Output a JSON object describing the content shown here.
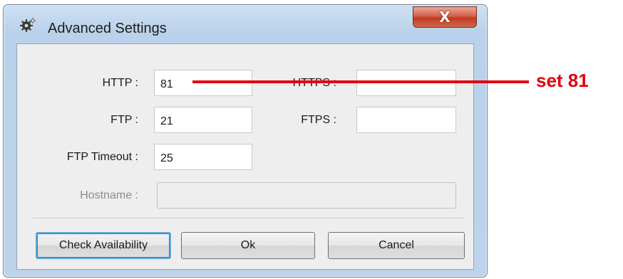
{
  "window": {
    "title": "Advanced Settings",
    "icon": "gear-icon",
    "close_glyph": "X"
  },
  "fields": {
    "http": {
      "label": "HTTP :",
      "value": "81"
    },
    "https": {
      "label": "HTTPS :",
      "value": ""
    },
    "ftp": {
      "label": "FTP :",
      "value": "21"
    },
    "ftps": {
      "label": "FTPS :",
      "value": ""
    },
    "ftp_timeout": {
      "label": "FTP Timeout :",
      "value": "25"
    },
    "hostname": {
      "label": "Hostname :",
      "value": "",
      "enabled": false
    }
  },
  "buttons": {
    "check_availability": "Check Availability",
    "ok": "Ok",
    "cancel": "Cancel"
  },
  "annotation": {
    "text": "set 81",
    "color": "#e3000f"
  }
}
